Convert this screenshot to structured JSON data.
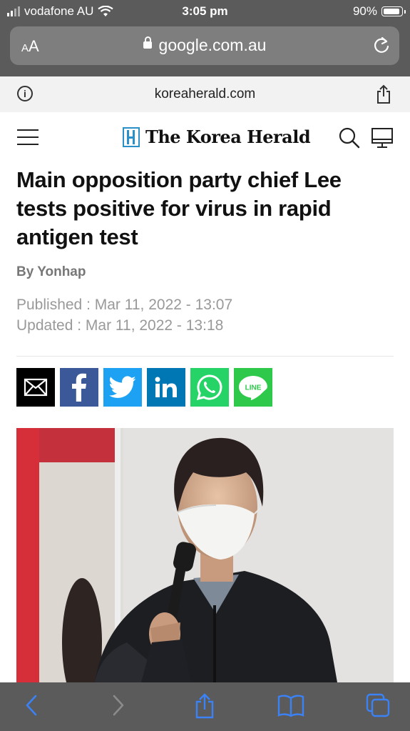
{
  "status_bar": {
    "carrier": "vodafone AU",
    "time": "3:05 pm",
    "battery": "90%",
    "battery_level": 0.9
  },
  "browser": {
    "aa_label_small": "A",
    "aa_label_large": "A",
    "url": "google.com.au",
    "site_domain": "koreaherald.com"
  },
  "site_header": {
    "logo_text": "The Korea Herald"
  },
  "article": {
    "headline": "Main opposition party chief Lee tests positive for virus in rapid antigen test",
    "byline": "By Yonhap",
    "published": "Published : Mar 11, 2022 - 13:07",
    "updated": "Updated : Mar 11, 2022 - 13:18"
  },
  "share_buttons": [
    {
      "name": "email",
      "color": "#000000"
    },
    {
      "name": "facebook",
      "color": "#3b5998"
    },
    {
      "name": "twitter",
      "color": "#1da1f2"
    },
    {
      "name": "linkedin",
      "color": "#0077b5"
    },
    {
      "name": "whatsapp",
      "color": "#25d366"
    },
    {
      "name": "line",
      "color": "#2ec94b"
    }
  ],
  "line_label": "LINE",
  "colors": {
    "chrome_gray": "#5b5b5b",
    "url_field": "#7e7e7e",
    "ios_blue": "#3b82f6",
    "logo_blue": "#2b8fc9"
  },
  "toolbar_icons": [
    "back-icon",
    "forward-icon",
    "share-icon",
    "bookmarks-icon",
    "tabs-icon"
  ]
}
